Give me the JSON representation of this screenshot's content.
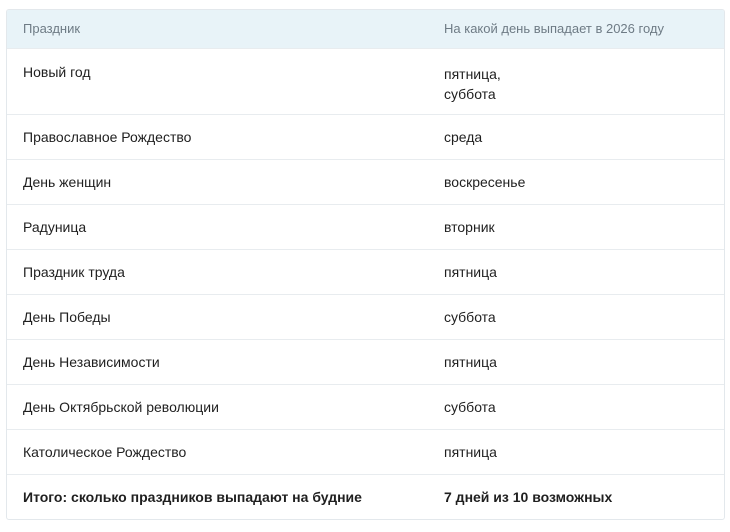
{
  "table": {
    "headers": [
      "Праздник",
      "На какой день выпадает в 2026 году"
    ],
    "rows": [
      {
        "holiday": "Новый год",
        "day": [
          "пятница,",
          "суббота"
        ]
      },
      {
        "holiday": "Православное Рождество",
        "day": [
          "среда"
        ]
      },
      {
        "holiday": "День женщин",
        "day": [
          "воскресенье"
        ]
      },
      {
        "holiday": "Радуница",
        "day": [
          "вторник"
        ]
      },
      {
        "holiday": "Праздник труда",
        "day": [
          "пятница"
        ]
      },
      {
        "holiday": "День Победы",
        "day": [
          "суббота"
        ]
      },
      {
        "holiday": "День Независимости",
        "day": [
          "пятница"
        ]
      },
      {
        "holiday": "День Октябрьской революции",
        "day": [
          "суббота"
        ]
      },
      {
        "holiday": "Католическое Рождество",
        "day": [
          "пятница"
        ]
      }
    ],
    "total": {
      "label": "Итого: сколько праздников выпадают на будние",
      "value": "7 дней из 10 возможных"
    }
  }
}
